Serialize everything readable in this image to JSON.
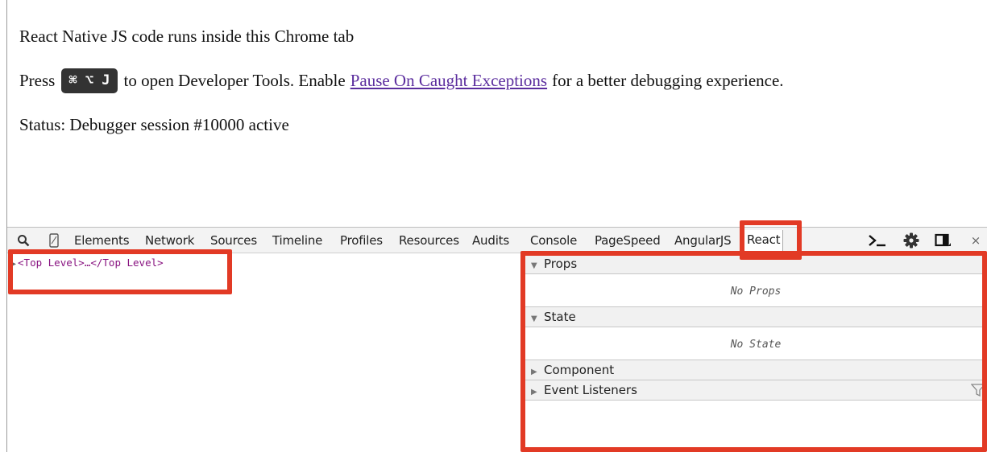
{
  "page": {
    "line1": "React Native JS code runs inside this Chrome tab",
    "line2_prefix": "Press",
    "shortcut": "⌘ ⌥ J",
    "line2_mid": "to open Developer Tools. Enable",
    "link_text": "Pause On Caught Exceptions",
    "line2_suffix": "for a better debugging experience.",
    "status": "Status: Debugger session #10000 active"
  },
  "devtools": {
    "tabs": [
      "Elements",
      "Network",
      "Sources",
      "Timeline",
      "Profiles",
      "Resources",
      "Audits",
      "Console",
      "PageSpeed",
      "AngularJS",
      "React"
    ],
    "active_tab": "React",
    "toolbar_icons": [
      "search-icon",
      "device-icon",
      "console-drawer-icon",
      "gear-icon",
      "dock-icon",
      "close-icon"
    ],
    "close_glyph": "×",
    "tree_root": "<Top Level>…</Top Level>",
    "sidebar": {
      "props_title": "Props",
      "props_empty": "No Props",
      "state_title": "State",
      "state_empty": "No State",
      "component_title": "Component",
      "listeners_title": "Event Listeners"
    }
  },
  "colors": {
    "highlight": "#e23a25",
    "link": "#5b2d9e",
    "tag": "#881280"
  }
}
